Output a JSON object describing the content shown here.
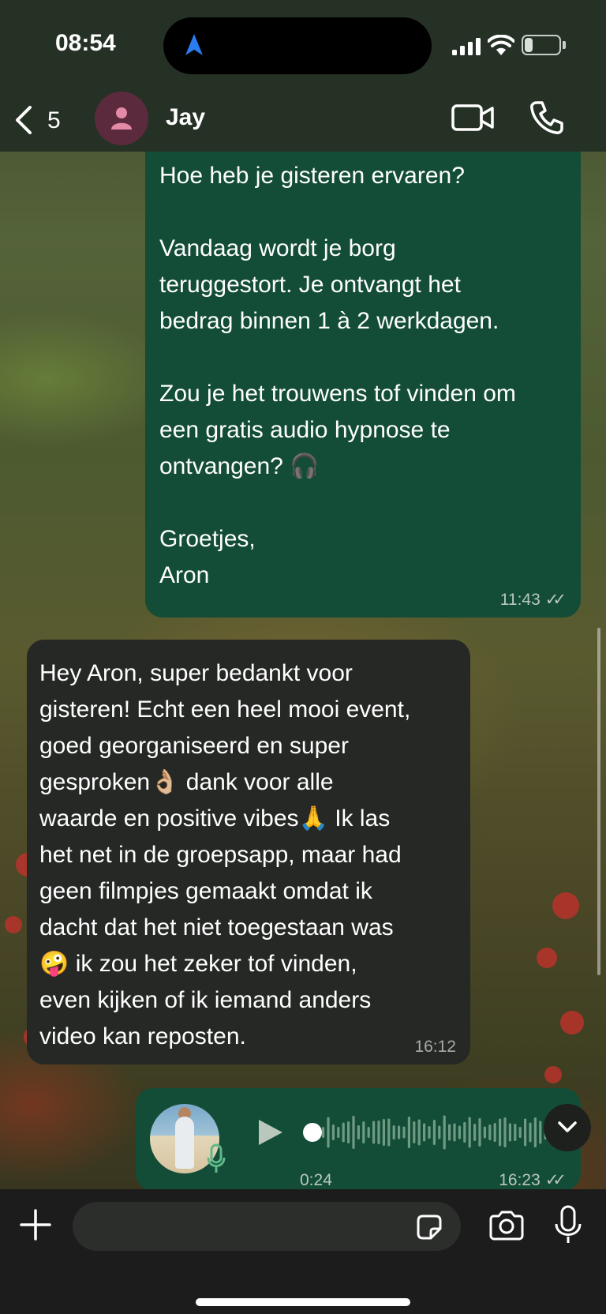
{
  "status_bar": {
    "time": "08:54",
    "battery": "24",
    "battery_level": 0.24
  },
  "header": {
    "back_count": "5",
    "contact_name": "Jay"
  },
  "messages": {
    "outgoing": {
      "text": "Hoe heb je gisteren ervaren?\n\nVandaag wordt je borg\nteruggestort. Je ontvangt het\nbedrag binnen 1 à 2 werkdagen.\n\nZou je het trouwens tof vinden om\neen gratis audio hypnose te\nontvangen? 🎧\n\nGroetjes,\nAron",
      "time": "11:43",
      "status": "✓✓"
    },
    "incoming": {
      "text": "Hey Aron, super bedankt voor\ngisteren! Echt een heel mooi event,\ngoed georganiseerd en super\ngesproken👌🏼 dank voor alle\nwaarde en positive vibes🙏 Ik las\nhet net in de groepsapp, maar had\ngeen filmpjes gemaakt omdat ik\ndacht dat het niet toegestaan was\n🤪 ik zou het zeker tof vinden,\neven kijken of ik iemand anders\nvideo kan reposten.",
      "time": "16:12"
    },
    "voice": {
      "duration": "0:24",
      "time": "16:23",
      "status": "✓✓",
      "progress": 0
    }
  },
  "input": {
    "placeholder": ""
  },
  "colors": {
    "outgoing_bubble": "#134d37",
    "incoming_bubble": "#252825",
    "header_bg": "#263126"
  },
  "icons": [
    "back-chevron-icon",
    "person-icon",
    "video-camera-icon",
    "phone-icon",
    "play-icon",
    "microphone-icon",
    "chevron-down-icon",
    "plus-icon",
    "sticker-icon",
    "camera-icon",
    "navigation-arrow-icon",
    "wifi-icon",
    "cellular-signal-icon"
  ]
}
